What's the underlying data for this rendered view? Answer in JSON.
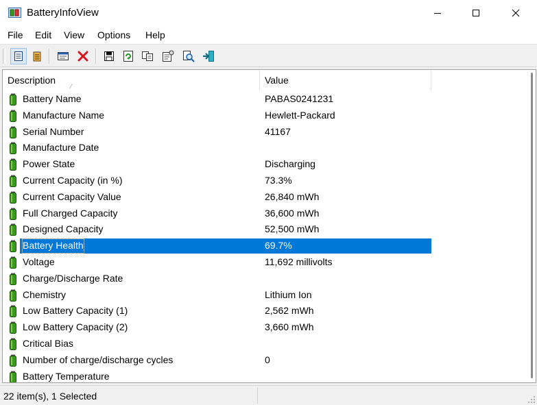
{
  "window": {
    "title": "BatteryInfoView"
  },
  "menu": [
    "File",
    "Edit",
    "View",
    "Options",
    "Help"
  ],
  "columns": {
    "description": "Description",
    "value": "Value"
  },
  "rows": [
    {
      "description": "Battery Name",
      "value": "PABAS0241231"
    },
    {
      "description": "Manufacture Name",
      "value": "Hewlett-Packard"
    },
    {
      "description": "Serial Number",
      "value": "41167"
    },
    {
      "description": "Manufacture Date",
      "value": ""
    },
    {
      "description": "Power State",
      "value": "Discharging"
    },
    {
      "description": "Current Capacity (in %)",
      "value": "73.3%"
    },
    {
      "description": "Current Capacity Value",
      "value": "26,840 mWh"
    },
    {
      "description": "Full Charged Capacity",
      "value": "36,600 mWh"
    },
    {
      "description": "Designed Capacity",
      "value": "52,500 mWh"
    },
    {
      "description": "Battery Health",
      "value": "69.7%",
      "selected": true
    },
    {
      "description": "Voltage",
      "value": "11,692 millivolts"
    },
    {
      "description": "Charge/Discharge Rate",
      "value": ""
    },
    {
      "description": "Chemistry",
      "value": "Lithium Ion"
    },
    {
      "description": "Low Battery Capacity (1)",
      "value": "2,562 mWh"
    },
    {
      "description": "Low Battery Capacity (2)",
      "value": "3,660 mWh"
    },
    {
      "description": "Critical Bias",
      "value": ""
    },
    {
      "description": "Number of charge/discharge cycles",
      "value": "0"
    },
    {
      "description": "Battery Temperature",
      "value": ""
    }
  ],
  "status": {
    "items_text": "22 item(s), 1 Selected"
  },
  "icons": {
    "row": "battery-icon",
    "toolbar": [
      "battery-info-mode-icon",
      "battery-log-mode-icon",
      "properties-window-icon",
      "delete-icon",
      "save-icon",
      "refresh-icon",
      "copy-icon",
      "properties-icon",
      "find-icon",
      "exit-icon"
    ]
  },
  "colors": {
    "selection": "#0078d7",
    "battery_green": "#3a9a1a"
  }
}
